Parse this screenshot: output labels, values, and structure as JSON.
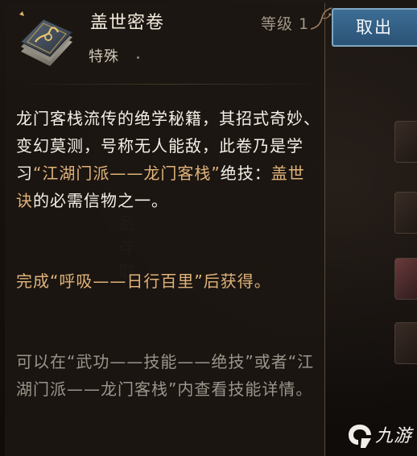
{
  "background": {
    "ghost_chars": [
      "物",
      "品",
      "存",
      "取"
    ]
  },
  "actions": {
    "take_out_label": "取出"
  },
  "item": {
    "name": "盖世密卷",
    "level_label": "等级 1",
    "type": "特殊",
    "type_trail": ".",
    "description_parts": [
      "龙门客栈流传的绝学秘籍，其招式奇妙、变幻莫测，号称无人能敌，此卷乃是学习",
      "“江湖门派——龙门客栈”",
      "绝技：",
      "盖世诀",
      "的必需信物之一。"
    ],
    "source": "完成“呼吸——日行百里”后获得。",
    "hint": "可以在“武功——技能——绝技”或者“江湖门派——龙门客栈”内查看技能详情。"
  },
  "watermark": {
    "text": "九游"
  },
  "colors": {
    "accent_gold": "#e0b37a",
    "button_blue": "#2a5275",
    "text_light": "#f4f0e6",
    "text_muted": "#9b958b"
  }
}
